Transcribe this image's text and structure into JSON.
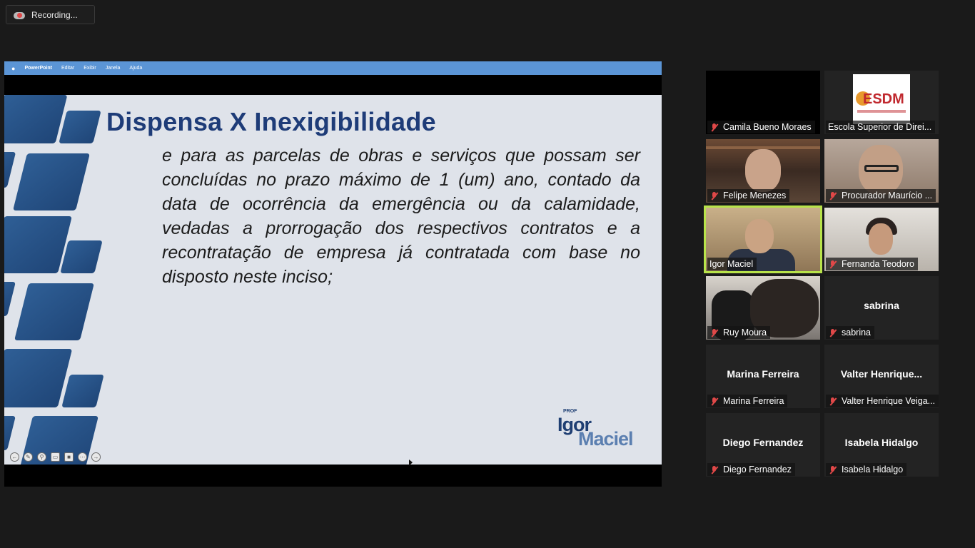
{
  "recording": {
    "label": "Recording...",
    "icon": "cloud-record-icon",
    "color": "#e04848"
  },
  "share": {
    "mac_menu": {
      "apple": "",
      "app": "PowerPoint",
      "items": [
        "Editar",
        "Exibir",
        "Janela",
        "Ajuda"
      ]
    },
    "slide": {
      "title": "Dispensa X Inexigibilidade",
      "body": "e para as parcelas de obras e serviços que possam ser concluídas no prazo máximo de 1 (um) ano, contado da data de ocorrência da emergência ou da calamidade, vedadas a prorrogação dos respectivos contratos e a recontratação de empresa já contratada com base no disposto neste inciso;",
      "logo": {
        "prof": "PROF",
        "line1": "Igor",
        "line2": "Maciel"
      }
    },
    "controls": [
      "previous-icon",
      "pen-icon",
      "zoom-icon",
      "subtitles-icon",
      "camera-off-icon",
      "more-icon",
      "next-icon"
    ]
  },
  "gallery": {
    "participants": [
      {
        "name": "Camila Bueno Moraes",
        "muted": true,
        "video": "black"
      },
      {
        "name": "Escola Superior de Direi...",
        "muted": false,
        "video": "logo",
        "logo_text": "ESDM"
      },
      {
        "name": "Felipe Menezes",
        "muted": true,
        "video": "camera"
      },
      {
        "name": "Procurador Maurício ...",
        "muted": true,
        "video": "camera"
      },
      {
        "name": "Igor Maciel",
        "muted": false,
        "video": "camera",
        "active_speaker": true
      },
      {
        "name": "Fernanda Teodoro",
        "muted": true,
        "video": "camera"
      },
      {
        "name": "Ruy Moura",
        "muted": true,
        "video": "camera"
      },
      {
        "name": "sabrina",
        "muted": true,
        "video": "off",
        "display": "sabrina"
      },
      {
        "name": "Marina Ferreira",
        "muted": true,
        "video": "off",
        "display": "Marina Ferreira"
      },
      {
        "name": "Valter Henrique Veiga...",
        "muted": true,
        "video": "off",
        "display": "Valter  Henrique..."
      },
      {
        "name": "Diego Fernandez",
        "muted": true,
        "video": "off",
        "display": "Diego Fernandez"
      },
      {
        "name": "Isabela Hidalgo",
        "muted": true,
        "video": "off",
        "display": "Isabela Hidalgo"
      }
    ]
  },
  "colors": {
    "active_speaker": "#b8e34a",
    "mute": "#e04848",
    "slide_title": "#1e3c78",
    "menu_bar": "#5b95d6"
  }
}
